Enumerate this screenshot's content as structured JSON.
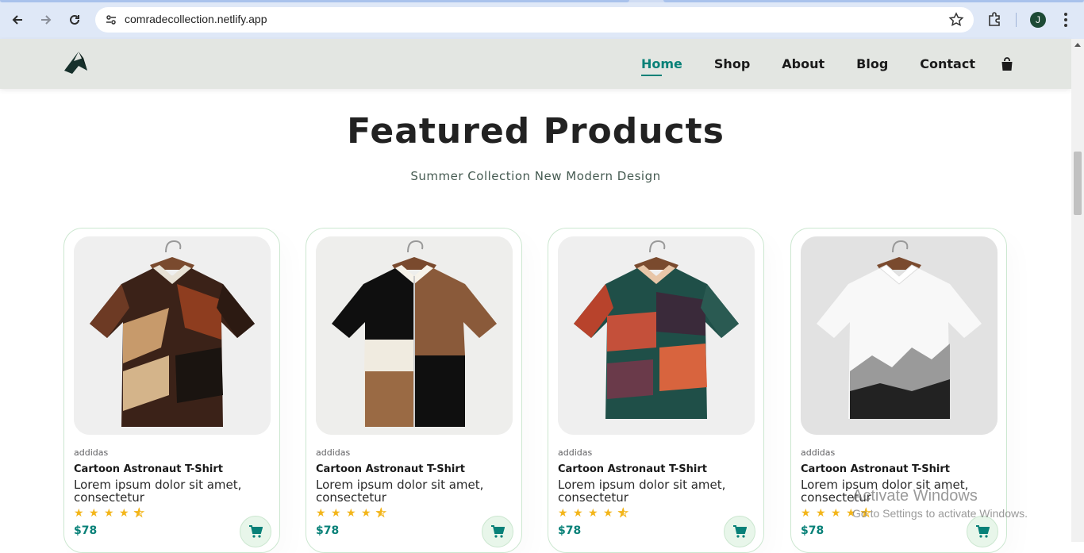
{
  "browser": {
    "url": "comradecollection.netlify.app",
    "profile_initial": "J"
  },
  "nav": {
    "items": [
      {
        "label": "Home",
        "active": true
      },
      {
        "label": "Shop"
      },
      {
        "label": "About"
      },
      {
        "label": "Blog"
      },
      {
        "label": "Contact"
      }
    ],
    "bag_icon": "shopping-bag-icon"
  },
  "featured": {
    "title": "Featured Products",
    "subtitle": "Summer Collection New Modern Design"
  },
  "products": [
    {
      "brand": "addidas",
      "name": "Cartoon Astronaut T-Shirt",
      "desc": "Lorem ipsum dolor sit amet, consectetur",
      "rating": 4.5,
      "price": "$78"
    },
    {
      "brand": "addidas",
      "name": "Cartoon Astronaut T-Shirt",
      "desc": "Lorem ipsum dolor sit amet, consectetur",
      "rating": 4.5,
      "price": "$78"
    },
    {
      "brand": "addidas",
      "name": "Cartoon Astronaut T-Shirt",
      "desc": "Lorem ipsum dolor sit amet, consectetur",
      "rating": 4.5,
      "price": "$78"
    },
    {
      "brand": "addidas",
      "name": "Cartoon Astronaut T-Shirt",
      "desc": "Lorem ipsum dolor sit amet, consectetur",
      "rating": 4.5,
      "price": "$78"
    }
  ],
  "watermark": {
    "line1": "Activate Windows",
    "line2": "Go to Settings to activate Windows."
  },
  "colors": {
    "accent": "#088178",
    "star": "#f3b519",
    "header_bg": "#e3e6e2"
  }
}
